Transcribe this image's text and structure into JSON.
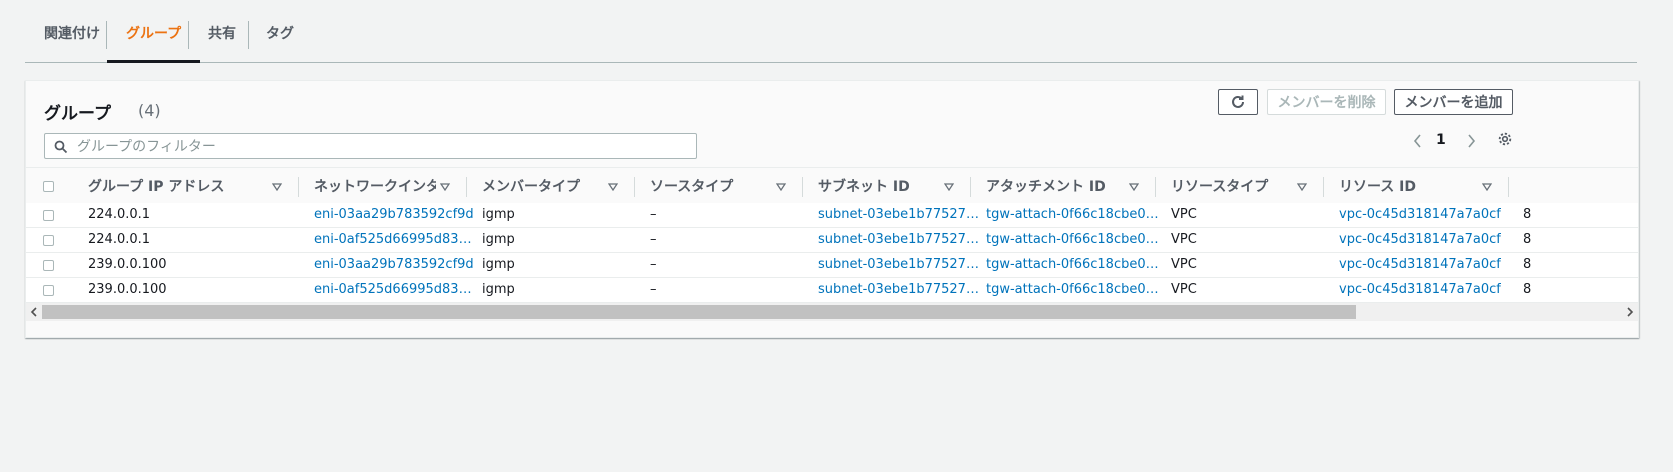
{
  "tabs": [
    {
      "label": "関連付け",
      "active": false
    },
    {
      "label": "グループ",
      "active": true
    },
    {
      "label": "共有",
      "active": false
    },
    {
      "label": "タグ",
      "active": false
    }
  ],
  "panel": {
    "title": "グループ",
    "count": "(4)",
    "refresh_icon": "refresh-icon",
    "remove_button": "メンバーを削除",
    "add_button": "メンバーを追加",
    "filter_placeholder": "グループのフィルター",
    "page": "1"
  },
  "table": {
    "columns": [
      "グループ IP アドレス",
      "ネットワークインタ…",
      "メンバータイプ",
      "ソースタイプ",
      "サブネット ID",
      "アタッチメント ID",
      "リソースタイプ",
      "リソース ID"
    ],
    "rows": [
      [
        "224.0.0.1",
        "eni-03aa29b783592cf9d",
        "igmp",
        "–",
        "subnet-03ebe1b77527…",
        "tgw-attach-0f66c18cbe0…",
        "VPC",
        "vpc-0c45d318147a7a0cf",
        "8"
      ],
      [
        "224.0.0.1",
        "eni-0af525d66995d83…",
        "igmp",
        "–",
        "subnet-03ebe1b77527…",
        "tgw-attach-0f66c18cbe0…",
        "VPC",
        "vpc-0c45d318147a7a0cf",
        "8"
      ],
      [
        "239.0.0.100",
        "eni-03aa29b783592cf9d",
        "igmp",
        "–",
        "subnet-03ebe1b77527…",
        "tgw-attach-0f66c18cbe0…",
        "VPC",
        "vpc-0c45d318147a7a0cf",
        "8"
      ],
      [
        "239.0.0.100",
        "eni-0af525d66995d83…",
        "igmp",
        "–",
        "subnet-03ebe1b77527…",
        "tgw-attach-0f66c18cbe0…",
        "VPC",
        "vpc-0c45d318147a7a0cf",
        "8"
      ]
    ]
  },
  "colors": {
    "accent": "#ec7211",
    "link": "#0073bb"
  }
}
